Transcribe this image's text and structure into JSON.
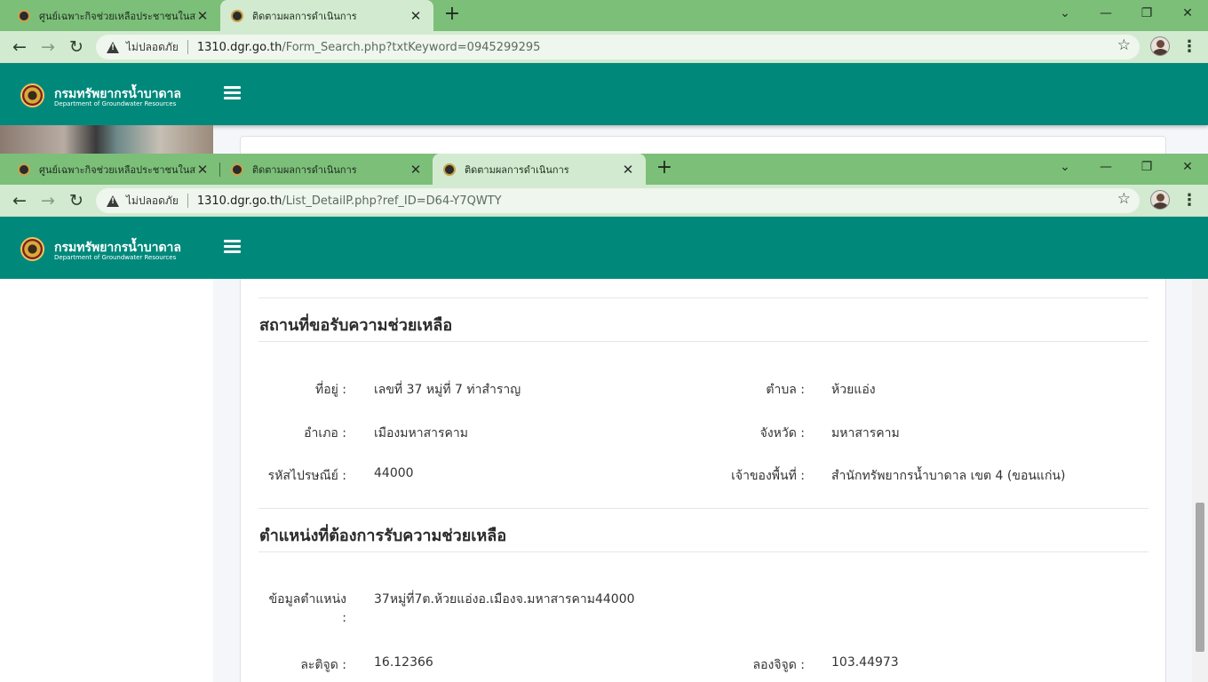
{
  "window1": {
    "tabs": [
      {
        "title": "ศูนย์เฉพาะกิจช่วยเหลือประชาชนในสถา"
      },
      {
        "title": "ติดตามผลการดำเนินการ"
      }
    ],
    "insecure_label": "ไม่ปลอดภัย",
    "url_host": "1310.dgr.go.th",
    "url_path": "/Form_Search.php?txtKeyword=0945299295"
  },
  "window2": {
    "tabs": [
      {
        "title": "ศูนย์เฉพาะกิจช่วยเหลือประชาชนในสถา"
      },
      {
        "title": "ติดตามผลการดำเนินการ"
      },
      {
        "title": "ติดตามผลการดำเนินการ"
      }
    ],
    "insecure_label": "ไม่ปลอดภัย",
    "url_host": "1310.dgr.go.th",
    "url_path": "/List_DetailP.php?ref_ID=D64-Y7QWTY"
  },
  "brand": {
    "name_th": "กรมทรัพยากรน้ำบาดาล",
    "name_en": "Department of Groundwater Resources"
  },
  "location_section": {
    "title": "สถานที่ขอรับความช่วยเหลือ",
    "address_label": "ที่อยู่ :",
    "address_value": "เลขที่ 37 หมู่ที่ 7 ท่าสำราญ",
    "subdistrict_label": "ตำบล :",
    "subdistrict_value": "ห้วยแอ่ง",
    "district_label": "อำเภอ :",
    "district_value": "เมืองมหาสารคาม",
    "province_label": "จังหวัด :",
    "province_value": "มหาสารคาม",
    "postcode_label": "รหัสไปรษณีย์ :",
    "postcode_value": "44000",
    "owner_label": "เจ้าของพื้นที่ :",
    "owner_value": "สำนักทรัพยากรน้ำบาดาล เขต 4 (ขอนแก่น)"
  },
  "position_section": {
    "title": "ตำแหน่งที่ต้องการรับความช่วยเหลือ",
    "info_label_line1": "ข้อมูลตำแหน่ง",
    "info_label_line2": ":",
    "info_value": "37หมู่ที่7ต.ห้วยแอ่งอ.เมืองจ.มหาสารคาม44000",
    "lat_label": "ละติจูด :",
    "lat_value": "16.12366",
    "lon_label": "ลองจิจูด :",
    "lon_value": "103.44973"
  }
}
